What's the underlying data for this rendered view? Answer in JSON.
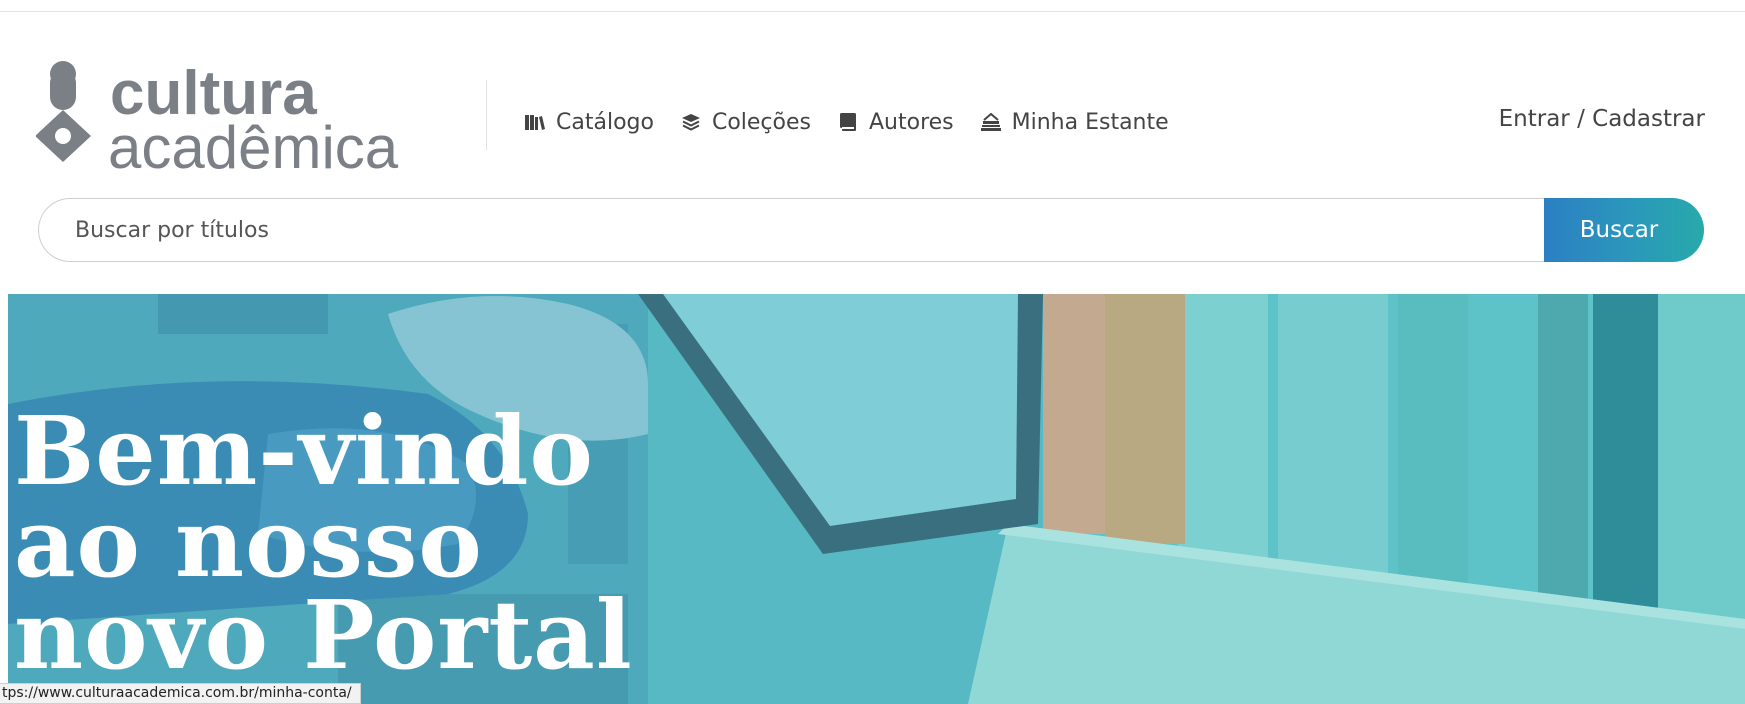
{
  "brand": {
    "name_line1": "cultura",
    "name_line2": "acadêmica",
    "colors": {
      "logo": "#7b7f86",
      "accent": "#2b98bb"
    }
  },
  "nav": {
    "items": [
      {
        "label": "Catálogo",
        "icon": "books-icon"
      },
      {
        "label": "Coleções",
        "icon": "layers-icon"
      },
      {
        "label": "Autores",
        "icon": "book-icon"
      },
      {
        "label": "Minha Estante",
        "icon": "bookshelf-stack-icon"
      }
    ],
    "login_label": "Entrar / Cadastrar"
  },
  "search": {
    "placeholder": "Buscar por títulos",
    "button_label": "Buscar"
  },
  "hero": {
    "title": "Bem-vindo ao nosso novo Portal"
  },
  "status_bar": {
    "url": "tps://www.culturaacademica.com.br/minha-conta/"
  }
}
